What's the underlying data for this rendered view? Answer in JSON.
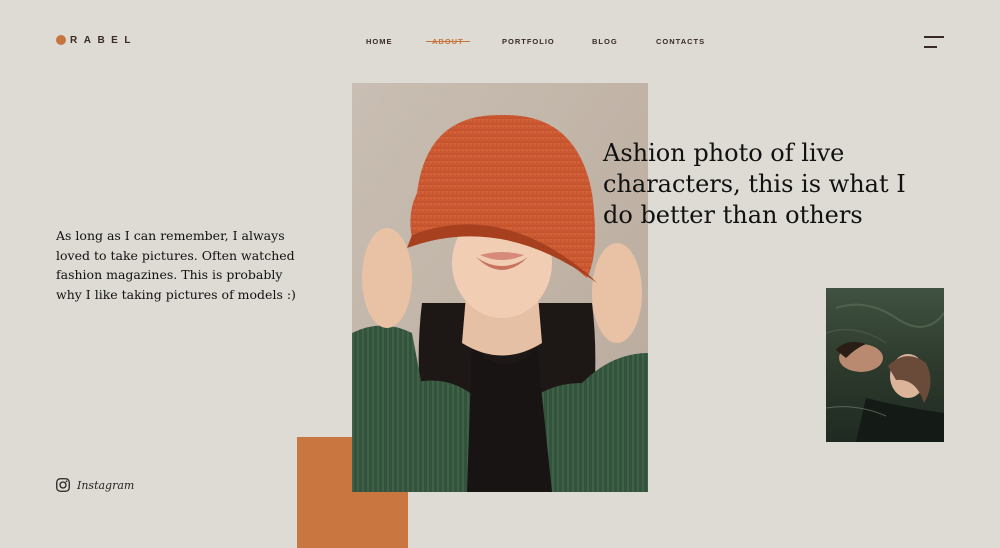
{
  "brand": {
    "logo_text": "RABEL",
    "accent": "#c8743f"
  },
  "nav": {
    "items": [
      {
        "label": "HOME"
      },
      {
        "label": "ABOUT",
        "active": true
      },
      {
        "label": "PORTFOLIO"
      },
      {
        "label": "BLOG"
      },
      {
        "label": "CONTACTS"
      }
    ]
  },
  "menu": {
    "icon": "hamburger-menu-icon"
  },
  "hero": {
    "headline": "Ashion photo of live characters, this is what I do better than others",
    "intro": "As long as I can remember, I always loved to take pictures. Often watched fashion magazines. This is probably why I like taking pictures of models :)"
  },
  "social": {
    "icon": "instagram-icon",
    "label": "Instagram"
  },
  "colors": {
    "background": "#dddbd4",
    "orange_block": "#c97641",
    "text": "#111111"
  }
}
